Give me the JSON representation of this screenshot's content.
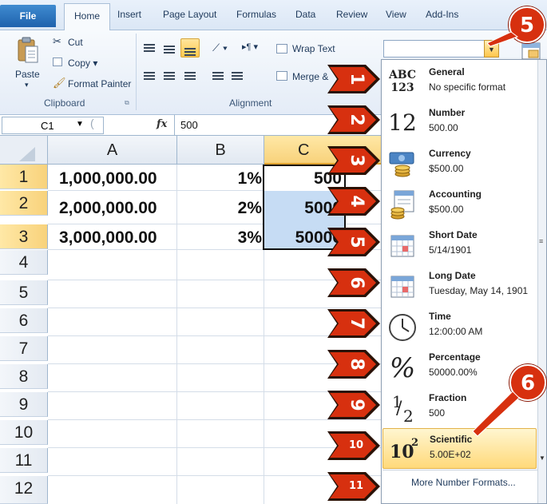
{
  "ribbon_tabs": [
    "File",
    "Home",
    "Insert",
    "Page Layout",
    "Formulas",
    "Data",
    "Review",
    "View",
    "Add-Ins"
  ],
  "clipboard": {
    "paste_label": "Paste",
    "cut_label": "Cut",
    "copy_label": "Copy ▾",
    "format_painter_label": "Format Painter",
    "group_label": "Clipboard"
  },
  "alignment": {
    "wrap_text_label": "Wrap Text",
    "merge_label": "Merge &",
    "group_label": "Alignment"
  },
  "formula_bar": {
    "name_box": "C1",
    "fx_label": "fx",
    "value": "500"
  },
  "grid": {
    "columns": [
      "A",
      "B",
      "C"
    ],
    "rows": [
      "1",
      "2",
      "3",
      "4",
      "5",
      "6",
      "7",
      "8",
      "9",
      "10",
      "11",
      "12"
    ],
    "cells": [
      {
        "a": "1,000,000.00",
        "b": "1%",
        "c": "500"
      },
      {
        "a": "2,000,000.00",
        "b": "2%",
        "c": "5000"
      },
      {
        "a": "3,000,000.00",
        "b": "3%",
        "c": "50000"
      }
    ]
  },
  "number_format_menu": {
    "items": [
      {
        "title": "General",
        "sub": "No specific format",
        "icon": "abc-123-icon"
      },
      {
        "title": "Number",
        "sub": "500.00",
        "icon": "number-12-icon"
      },
      {
        "title": "Currency",
        "sub": "$500.00",
        "icon": "currency-icon"
      },
      {
        "title": "Accounting",
        "sub": " $500.00",
        "icon": "accounting-icon"
      },
      {
        "title": "Short Date",
        "sub": "5/14/1901",
        "icon": "calendar-icon"
      },
      {
        "title": "Long Date",
        "sub": "Tuesday, May 14, 1901",
        "icon": "calendar-icon"
      },
      {
        "title": "Time",
        "sub": "12:00:00 AM",
        "icon": "clock-icon"
      },
      {
        "title": "Percentage",
        "sub": "50000.00%",
        "icon": "percent-icon"
      },
      {
        "title": "Fraction",
        "sub": "500",
        "icon": "fraction-icon"
      },
      {
        "title": "Scientific",
        "sub": "5.00E+02",
        "icon": "scientific-icon"
      }
    ],
    "footer": "More Number Formats..."
  },
  "icon_glyphs": {
    "general_top": "ABC",
    "general_bottom": "123",
    "number": "12",
    "percent": "%",
    "fraction_num": "1",
    "fraction_den": "2",
    "sci_base": "10",
    "sci_exp": "2"
  },
  "callouts": [
    "1",
    "2",
    "3",
    "4",
    "5",
    "6",
    "7",
    "8",
    "9",
    "10",
    "11"
  ],
  "badges": [
    "5",
    "6"
  ],
  "colors": {
    "callout_fill": "#d7300f",
    "selection_fill": "#c6dcf4",
    "highlight": "#ffd97a"
  }
}
